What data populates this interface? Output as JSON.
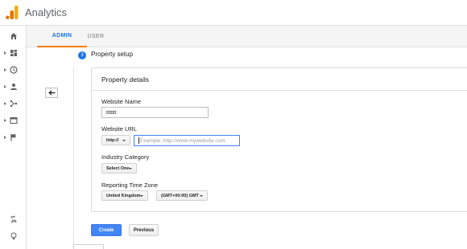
{
  "app": {
    "title": "Analytics"
  },
  "tabs": [
    {
      "label": "ADMIN",
      "active": true
    },
    {
      "label": "USER",
      "active": false
    }
  ],
  "sidebar": {
    "items": [
      {
        "icon": "home-icon",
        "expandable": false
      },
      {
        "icon": "customization-icon",
        "expandable": true
      },
      {
        "icon": "realtime-clock-icon",
        "expandable": true
      },
      {
        "icon": "audience-person-icon",
        "expandable": true
      },
      {
        "icon": "acquisition-icon",
        "expandable": true
      },
      {
        "icon": "behavior-icon",
        "expandable": true
      },
      {
        "icon": "conversions-flag-icon",
        "expandable": true
      },
      {
        "icon": "discover-icon",
        "expandable": false
      },
      {
        "icon": "lightbulb-icon",
        "expandable": false
      }
    ]
  },
  "step": {
    "number": "3",
    "title": "Property setup"
  },
  "card": {
    "title": "Property details",
    "website_name": {
      "label": "Website Name",
      "value": "ttttttt"
    },
    "website_url": {
      "label": "Website URL",
      "protocol": "http://",
      "placeholder": "Example: http://www.mywebsite.com"
    },
    "industry": {
      "label": "Industry Category",
      "value": "Select One"
    },
    "timezone": {
      "label": "Reporting Time Zone",
      "country": "United Kingdom",
      "zone": "(GMT+00:00) GMT"
    }
  },
  "buttons": {
    "create": "Create",
    "previous": "Previous"
  },
  "colors": {
    "accent": "#1a73e8",
    "tab_underline": "#f57c00",
    "primary_button": "#4285f4"
  }
}
